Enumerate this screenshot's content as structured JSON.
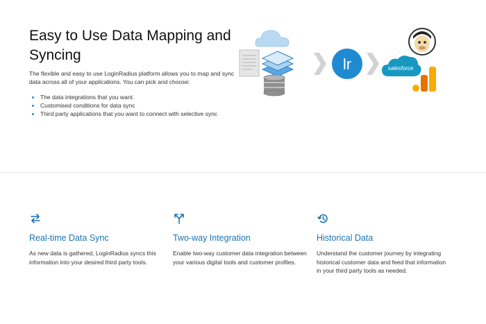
{
  "hero": {
    "title": "Easy to Use Data Mapping and Syncing",
    "description": "The flexible and easy to use LoginRadius platform allows you to map and sync data across all of your applications. You can pick and choose:",
    "bullets": [
      "The data integrations that you want.",
      "Customised conditions for data sync",
      "Third party applications that you want to connect with selective sync"
    ]
  },
  "illustration": {
    "center_logo_text": "lr",
    "salesforce_label": "salesforce",
    "icons": [
      "cloud-icon",
      "document-icon",
      "layers-icon",
      "database-icon",
      "chevron-right-icon",
      "loginradius-logo",
      "mailchimp-logo",
      "salesforce-logo",
      "google-analytics-logo"
    ]
  },
  "features": [
    {
      "icon": "sync-arrows-icon",
      "title": "Real-time Data Sync",
      "description": "As new data is gathered, LoginRadius syncs this information into your desired third party tools."
    },
    {
      "icon": "merge-split-icon",
      "title": "Two-way Integration",
      "description": "Enable two-way customer data integration between your various digital tools and customer profiles."
    },
    {
      "icon": "history-icon",
      "title": "Historical Data",
      "description": "Understand the customer journey by integrating historical customer data and feed that information in your third party tools as needed."
    }
  ],
  "colors": {
    "accent": "#1b73b3",
    "loginradius_blue": "#1f8ad1",
    "salesforce_blue": "#1798c1",
    "analytics_orange": "#f9ab00",
    "analytics_dark": "#e37400"
  }
}
